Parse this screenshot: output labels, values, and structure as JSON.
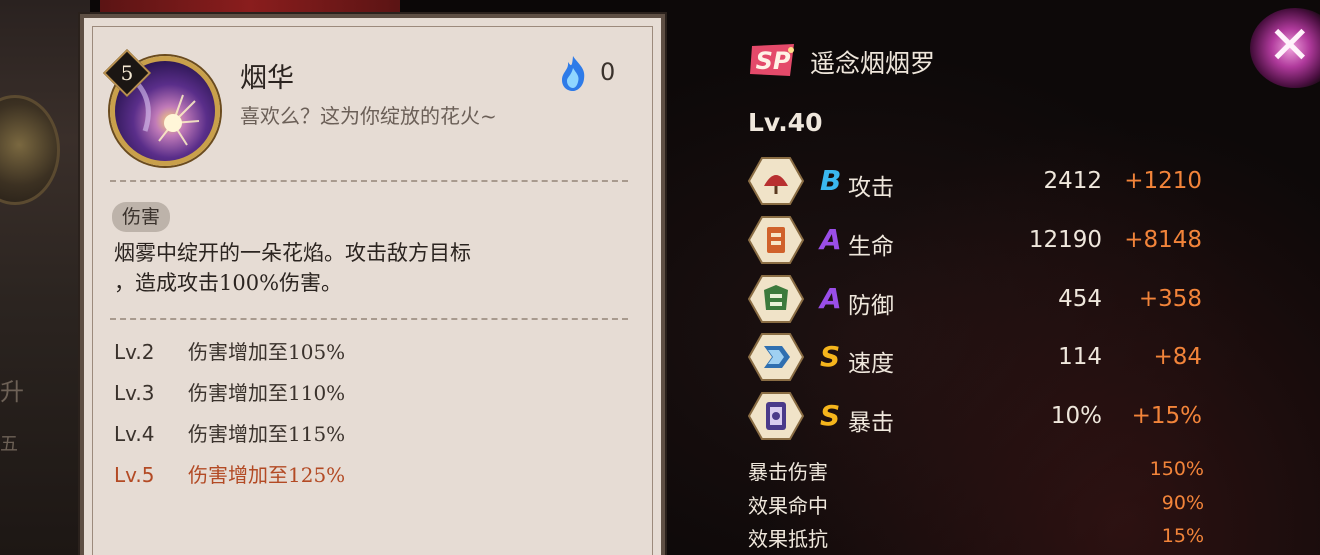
{
  "skill": {
    "level": "5",
    "name": "烟华",
    "quote": "喜欢么？这为你绽放的花火~",
    "cost": "0",
    "tag": "伤害",
    "description_line1": "烟雾中绽开的一朵花焰。攻击敌方目标",
    "description_line2": "，造成攻击100%伤害。",
    "upgrades": [
      {
        "lv": "Lv.2",
        "text": "伤害增加至105%"
      },
      {
        "lv": "Lv.3",
        "text": "伤害增加至110%"
      },
      {
        "lv": "Lv.4",
        "text": "伤害增加至115%"
      },
      {
        "lv": "Lv.5",
        "text": "伤害增加至125%"
      }
    ],
    "colors": {
      "panel": "#e6dcd4",
      "active_level": "#b34a24"
    }
  },
  "shikigami": {
    "rarity_badge": "SP",
    "name": "遥念烟烟罗",
    "level": "Lv.40",
    "stats": [
      {
        "icon": "fan-attack-icon",
        "grade": "B",
        "grade_color": "#3ab7ef",
        "label": "攻击",
        "base": "2412",
        "bonus": "+1210"
      },
      {
        "icon": "talisman-health-icon",
        "grade": "A",
        "grade_color": "#9a4ee8",
        "label": "生命",
        "base": "12190",
        "bonus": "+8148"
      },
      {
        "icon": "armor-defense-icon",
        "grade": "A",
        "grade_color": "#9a4ee8",
        "label": "防御",
        "base": "454",
        "bonus": "+358"
      },
      {
        "icon": "chevron-speed-icon",
        "grade": "S",
        "grade_color": "#f5b51c",
        "label": "速度",
        "base": "114",
        "bonus": "+84"
      },
      {
        "icon": "scroll-crit-icon",
        "grade": "S",
        "grade_color": "#f5b51c",
        "label": "暴击",
        "base": "10%",
        "bonus": "+15%"
      }
    ],
    "extra_stats": [
      {
        "label": "暴击伤害",
        "value": "150%"
      },
      {
        "label": "效果命中",
        "value": "90%"
      },
      {
        "label": "效果抵抗",
        "value": "15%"
      }
    ],
    "colors": {
      "bonus": "#f2843a",
      "text": "#efe7dc"
    }
  }
}
